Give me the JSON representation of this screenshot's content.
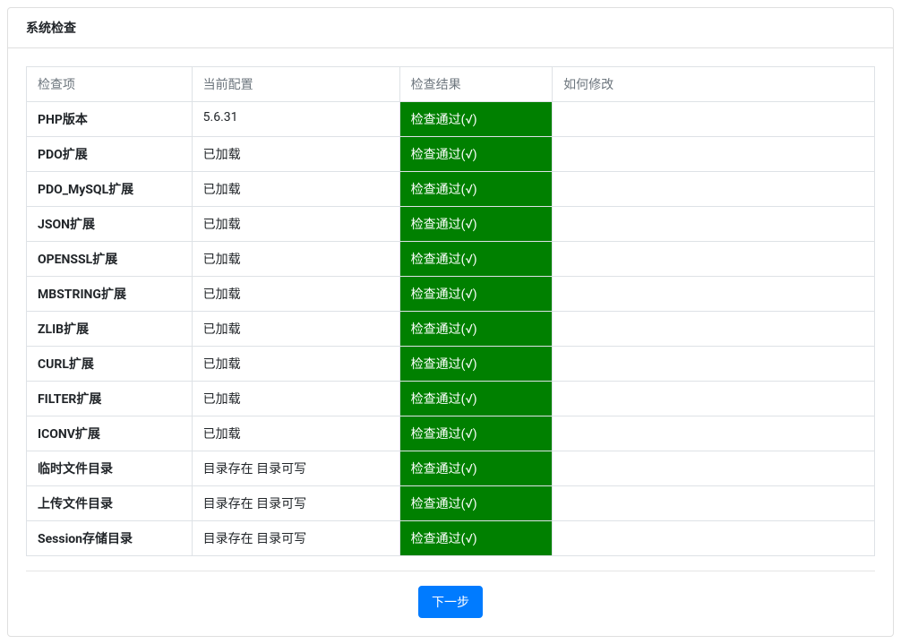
{
  "title": "系统检查",
  "columns": {
    "check_item": "检查项",
    "current_config": "当前配置",
    "check_result": "检查结果",
    "how_to_fix": "如何修改"
  },
  "rows": [
    {
      "item": "PHP版本",
      "config": "5.6.31",
      "result": "检查通过(√)",
      "howto": ""
    },
    {
      "item": "PDO扩展",
      "config": "已加载",
      "result": "检查通过(√)",
      "howto": ""
    },
    {
      "item": "PDO_MySQL扩展",
      "config": "已加载",
      "result": "检查通过(√)",
      "howto": ""
    },
    {
      "item": "JSON扩展",
      "config": "已加载",
      "result": "检查通过(√)",
      "howto": ""
    },
    {
      "item": "OPENSSL扩展",
      "config": "已加载",
      "result": "检查通过(√)",
      "howto": ""
    },
    {
      "item": "MBSTRING扩展",
      "config": "已加载",
      "result": "检查通过(√)",
      "howto": ""
    },
    {
      "item": "ZLIB扩展",
      "config": "已加载",
      "result": "检查通过(√)",
      "howto": ""
    },
    {
      "item": "CURL扩展",
      "config": "已加载",
      "result": "检查通过(√)",
      "howto": ""
    },
    {
      "item": "FILTER扩展",
      "config": "已加载",
      "result": "检查通过(√)",
      "howto": ""
    },
    {
      "item": "ICONV扩展",
      "config": "已加载",
      "result": "检查通过(√)",
      "howto": ""
    },
    {
      "item": "临时文件目录",
      "config": "目录存在 目录可写",
      "result": "检查通过(√)",
      "howto": ""
    },
    {
      "item": "上传文件目录",
      "config": "目录存在 目录可写",
      "result": "检查通过(√)",
      "howto": ""
    },
    {
      "item": "Session存储目录",
      "config": "目录存在 目录可写",
      "result": "检查通过(√)",
      "howto": ""
    }
  ],
  "next_button": "下一步"
}
